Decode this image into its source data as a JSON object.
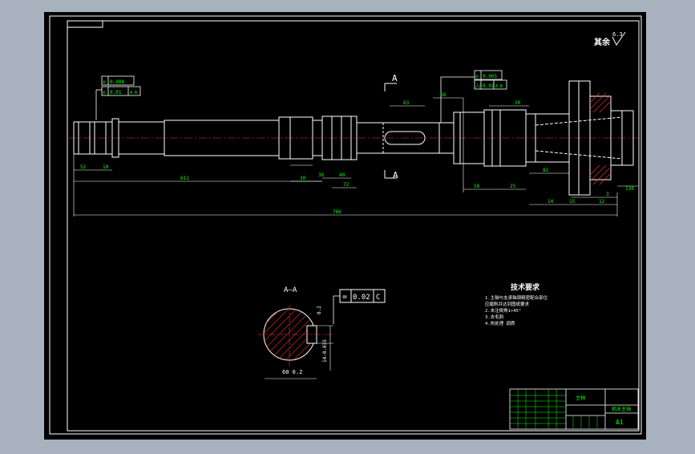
{
  "colors": {
    "background": "#a8b2bf",
    "paper": "#000000",
    "line": "#ffffff",
    "dimension": "#00ff00",
    "center": "#ff3030"
  },
  "drawing": {
    "roughness_label": "其余",
    "roughness_value": "6.3",
    "section_label_top": "A",
    "section_label_bottom": "A",
    "section_title": "A—A",
    "tolerance_a": {
      "symbol": "◎",
      "value": "0.008",
      "datum": "A-B"
    },
    "tolerance_b": {
      "symbol": "◎",
      "value": "0.01",
      "datum": "A-B"
    },
    "tolerance_c": {
      "symbol": "◎",
      "value": "0.005",
      "datum": "A-B"
    },
    "tolerance_d": {
      "symbol": "//",
      "value": "0.01",
      "datum": "A-B"
    },
    "section_tolerance": {
      "symbol": "=",
      "value": "0.02",
      "datum": "C"
    },
    "dims": {
      "d_total": "786",
      "d_611": "611",
      "d_63": "63",
      "d_68": "68",
      "d_30": "30",
      "d_36": "36",
      "d_40": "40",
      "d_72": "72",
      "d_58": "58",
      "d_25": "25",
      "d_82": "82",
      "d_20": "20",
      "d_14": "14",
      "d_15": "15",
      "d_12": "12",
      "d_3": "3",
      "d_52": "52",
      "d_10": "10",
      "d_130": "130",
      "section_depth": "60 0.2",
      "section_width": "14-0.035",
      "section_small": "0.2"
    },
    "notes": {
      "title": "技术要求",
      "lines": [
        "1.主轴与支承轴颈精密配合部位",
        "  应磨削并达到图纸要求",
        "2.未注倒角1×45°",
        "3.去毛刺",
        "4.热处理 调质"
      ]
    },
    "title_block": {
      "part_name": "主轴",
      "drawing_title": "机床主轴",
      "sheet_size": "A1"
    }
  }
}
